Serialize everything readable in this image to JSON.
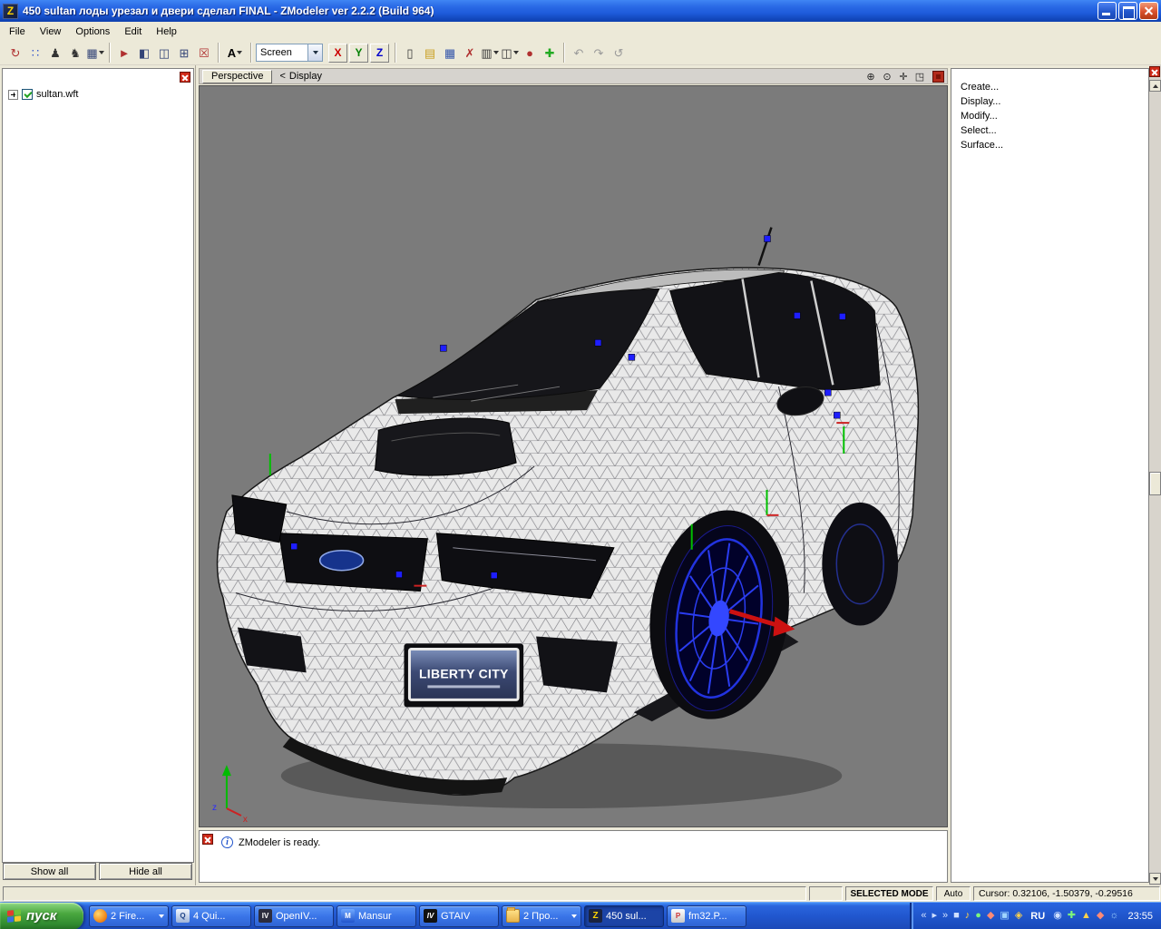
{
  "colors": {
    "titlebar_blue": "#1e5bdb",
    "taskbar_blue": "#2157cf",
    "start_green": "#3a9a35",
    "viewport_gray": "#7b7b7b",
    "wheel_blue": "#2a3cf0",
    "marker_blue": "#1e1eff",
    "close_red": "#cf2b1a"
  },
  "titlebar": {
    "title": "450 sultan лоды урезал и двери сделал FINAL - ZModeler ver 2.2.2 (Build 964)",
    "icon_letter": "Z"
  },
  "menu": {
    "items": [
      "File",
      "View",
      "Options",
      "Edit",
      "Help"
    ]
  },
  "toolbar": {
    "g1": [
      {
        "name": "rotate-tool",
        "glyph": "↻"
      },
      {
        "name": "vertex-mode-tool",
        "glyph": "∷"
      },
      {
        "name": "bone-tool",
        "glyph": "♟"
      },
      {
        "name": "figure-tool",
        "glyph": "♞"
      },
      {
        "name": "grid-snap-tool",
        "glyph": "▦"
      }
    ],
    "g2": [
      {
        "name": "marker-tool",
        "glyph": "►"
      },
      {
        "name": "viewport-layout-single",
        "glyph": "◧"
      },
      {
        "name": "viewport-layout-split",
        "glyph": "◫"
      },
      {
        "name": "viewport-layout-quad",
        "glyph": "⊞"
      },
      {
        "name": "viewport-delete",
        "glyph": "☒"
      }
    ],
    "letter_button": "A",
    "screen_combo": "Screen",
    "axis": [
      "X",
      "Y",
      "Z"
    ],
    "g3": [
      {
        "name": "new-file",
        "glyph": "▯"
      },
      {
        "name": "open-file",
        "glyph": "▤"
      },
      {
        "name": "save-file",
        "glyph": "▦"
      },
      {
        "name": "delete-object",
        "glyph": "✗"
      },
      {
        "name": "paste-object",
        "glyph": "▥"
      },
      {
        "name": "copy-object",
        "glyph": "◫"
      },
      {
        "name": "record-animation",
        "glyph": "●"
      },
      {
        "name": "plugins",
        "glyph": "✚"
      }
    ],
    "g4": [
      {
        "name": "undo",
        "glyph": "↶"
      },
      {
        "name": "redo",
        "glyph": "↷"
      },
      {
        "name": "history",
        "glyph": "↺"
      }
    ]
  },
  "left_panel": {
    "file_item": "sultan.wft",
    "show_all": "Show all",
    "hide_all": "Hide all"
  },
  "viewport": {
    "mode_button": "Perspective",
    "nav_arrow": "<",
    "display_label": "Display",
    "tools": [
      {
        "name": "zoom-in-icon",
        "glyph": "⊕"
      },
      {
        "name": "zoom-select-icon",
        "glyph": "⊙"
      },
      {
        "name": "pan-icon",
        "glyph": "✛"
      },
      {
        "name": "maximize-view-icon",
        "glyph": "◳"
      }
    ],
    "plate": "LIBERTY CITY",
    "gizmo": {
      "x": "x",
      "z": "z"
    }
  },
  "right_panel": {
    "items": [
      "Create...",
      "Display...",
      "Modify...",
      "Select...",
      "Surface..."
    ]
  },
  "log": {
    "message": "ZModeler is ready."
  },
  "statusbar": {
    "mode": "SELECTED MODE",
    "auto_label": "Auto",
    "cursor": "Cursor: 0.32106, -1.50379, -0.29516"
  },
  "taskbar": {
    "start_label": "пуск",
    "buttons": [
      {
        "label": "2 Fire...",
        "icon_text": "",
        "grouped": true
      },
      {
        "label": "4 Qui...",
        "icon_text": "Q",
        "grouped": false
      },
      {
        "label": "OpenIV...",
        "icon_text": "IV",
        "grouped": false
      },
      {
        "label": "Mansur",
        "icon_text": "M",
        "grouped": false
      },
      {
        "label": "GTAIV",
        "icon_text": "IV",
        "grouped": false
      },
      {
        "label": "2 Про...",
        "icon_text": "",
        "grouped": true
      },
      {
        "label": "450 sul...",
        "icon_text": "Z",
        "grouped": false,
        "active": true
      },
      {
        "label": "fm32.P...",
        "icon_text": "P",
        "grouped": false
      }
    ],
    "tray_left": [
      {
        "name": "media-rewind-icon",
        "glyph": "«"
      },
      {
        "name": "media-play-icon",
        "glyph": "▸"
      },
      {
        "name": "media-forward-icon",
        "glyph": "»"
      },
      {
        "name": "media-stop-icon",
        "glyph": "■"
      },
      {
        "name": "volume-icon",
        "glyph": "♪"
      },
      {
        "name": "messenger-icon",
        "glyph": "●"
      },
      {
        "name": "antivirus-icon",
        "glyph": "◆"
      },
      {
        "name": "network-icon",
        "glyph": "▣"
      },
      {
        "name": "update-icon",
        "glyph": "◈"
      }
    ],
    "language": "RU",
    "tray_right": [
      {
        "name": "tray-app-1-icon",
        "glyph": "◉"
      },
      {
        "name": "tray-app-2-icon",
        "glyph": "✚"
      },
      {
        "name": "tray-app-3-icon",
        "glyph": "▲"
      },
      {
        "name": "tray-app-4-icon",
        "glyph": "◆"
      },
      {
        "name": "tray-app-5-icon",
        "glyph": "☼"
      }
    ],
    "clock": "23:55"
  }
}
